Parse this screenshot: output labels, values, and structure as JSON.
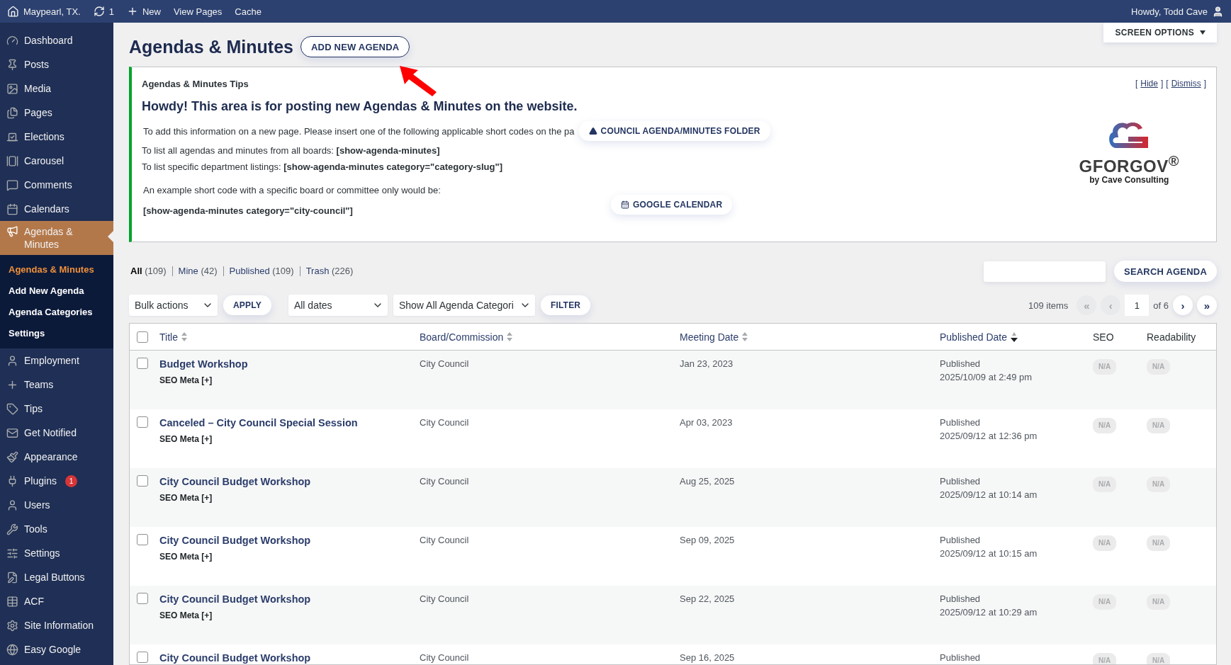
{
  "topbar": {
    "site": "Maypearl, TX.",
    "updates": "1",
    "new": "New",
    "links": [
      "View Pages",
      "Cache"
    ],
    "greeting": "Howdy, Todd Cave"
  },
  "sidebar": {
    "items": [
      {
        "label": "Dashboard",
        "selected": false
      },
      {
        "label": "Posts",
        "selected": false
      },
      {
        "label": "Media",
        "selected": false
      },
      {
        "label": "Pages",
        "selected": false
      },
      {
        "label": "Elections",
        "selected": false
      },
      {
        "label": "Carousel",
        "selected": false
      },
      {
        "label": "Comments",
        "selected": false
      },
      {
        "label": "Calendars",
        "selected": false
      },
      {
        "label": "Agendas & Minutes",
        "selected": true,
        "children": [
          {
            "label": "Agendas & Minutes",
            "selected": true
          },
          {
            "label": "Add New Agenda",
            "selected": false
          },
          {
            "label": "Agenda Categories",
            "selected": false
          },
          {
            "label": "Settings",
            "selected": false
          }
        ]
      },
      {
        "label": "Employment",
        "selected": false
      },
      {
        "label": "Teams",
        "selected": false
      },
      {
        "label": "Tips",
        "selected": false
      },
      {
        "label": "Get Notified",
        "selected": false
      },
      {
        "label": "Appearance",
        "selected": false
      },
      {
        "label": "Plugins",
        "selected": false,
        "badge": "1"
      },
      {
        "label": "Users",
        "selected": false
      },
      {
        "label": "Tools",
        "selected": false
      },
      {
        "label": "Settings",
        "selected": false
      },
      {
        "label": "Legal Buttons",
        "selected": false
      },
      {
        "label": "ACF",
        "selected": false
      },
      {
        "label": "Site Information",
        "selected": false
      },
      {
        "label": "Easy Google",
        "selected": false
      }
    ]
  },
  "screen_options": "SCREEN OPTIONS",
  "page_title": "Agendas & Minutes",
  "add_new_button": "ADD NEW AGENDA",
  "tips": {
    "title": "Agendas & Minutes Tips",
    "headline": "Howdy! This area is for posting new Agendas & Minutes on the website.",
    "intro": "To add this information on a new page. Please insert one of the following applicable short codes on the pa",
    "lines": [
      "To list all agendas and minutes from all boards: **[show-agenda-minutes]**",
      "To list specific department listings: **[show-agenda-minutes category=\"category-slug\"]**"
    ],
    "example": "An example short code with a specific board or committee only would be:",
    "example_code": "[show-agenda-minutes category=\"city-council\"]",
    "folder_button": "COUNCIL AGENDA/MINUTES FOLDER",
    "calendar_button": "GOOGLE CALENDAR",
    "links": [
      {
        "open": "[",
        "label": "Hide",
        "close": "]"
      },
      {
        "open": "[",
        "label": "Dismiss",
        "close": "]"
      }
    ],
    "logo": {
      "name": "GFORGOV",
      "mark": "®",
      "byline": "by Cave Consulting"
    }
  },
  "views": [
    {
      "label": "All",
      "count": "(109)",
      "selected": true
    },
    {
      "label": "Mine",
      "count": "(42)",
      "selected": false
    },
    {
      "label": "Published",
      "count": "(109)",
      "selected": false
    },
    {
      "label": "Trash",
      "count": "(226)",
      "selected": false
    }
  ],
  "search": {
    "button": "SEARCH AGENDA"
  },
  "toolbar": {
    "bulk": "Bulk actions",
    "apply": "APPLY",
    "dates": "All dates",
    "categories": "Show All Agenda Categori",
    "filter": "FILTER"
  },
  "pagination": {
    "items": "109 items",
    "first": {
      "label": "«",
      "disabled": true
    },
    "prev": {
      "label": "‹",
      "disabled": true
    },
    "page": "1",
    "of": "of 6",
    "next": {
      "label": "›",
      "disabled": false
    },
    "last": {
      "label": "»",
      "disabled": false
    }
  },
  "table": {
    "select_all": false,
    "columns": [
      {
        "label": "Title",
        "sortable": true,
        "sorted": false
      },
      {
        "label": "Board/Commission",
        "sortable": true,
        "sorted": false
      },
      {
        "label": "Meeting Date",
        "sortable": true,
        "sorted": false
      },
      {
        "label": "Published Date",
        "sortable": true,
        "sorted": true
      },
      {
        "label": "SEO",
        "sortable": false
      },
      {
        "label": "Readability",
        "sortable": false
      }
    ],
    "rows": [
      {
        "checked": false,
        "title": "Budget Workshop",
        "meta": "SEO Meta [+]",
        "board": "City Council",
        "meeting": "Jan 23, 2023",
        "status": "Published",
        "published": "2025/10/09 at 2:49 pm",
        "seo": "N/A",
        "readability": "N/A"
      },
      {
        "checked": false,
        "title": "Canceled – City Council Special Session",
        "meta": "SEO Meta [+]",
        "board": "City Council",
        "meeting": "Apr 03, 2023",
        "status": "Published",
        "published": "2025/09/12 at 12:36 pm",
        "seo": "N/A",
        "readability": "N/A"
      },
      {
        "checked": false,
        "title": "City Council Budget Workshop",
        "meta": "SEO Meta [+]",
        "board": "City Council",
        "meeting": "Aug 25, 2025",
        "status": "Published",
        "published": "2025/09/12 at 10:14 am",
        "seo": "N/A",
        "readability": "N/A"
      },
      {
        "checked": false,
        "title": "City Council Budget Workshop",
        "meta": "SEO Meta [+]",
        "board": "City Council",
        "meeting": "Sep 09, 2025",
        "status": "Published",
        "published": "2025/09/12 at 10:15 am",
        "seo": "N/A",
        "readability": "N/A"
      },
      {
        "checked": false,
        "title": "City Council Budget Workshop",
        "meta": "SEO Meta [+]",
        "board": "City Council",
        "meeting": "Sep 22, 2025",
        "status": "Published",
        "published": "2025/09/12 at 10:29 am",
        "seo": "N/A",
        "readability": "N/A"
      },
      {
        "checked": false,
        "title": "City Council Budget Workshop",
        "board": "City Council",
        "meeting": "Sep 16, 2025",
        "status": "Published",
        "seo": "N/A",
        "readability": "N/A"
      }
    ]
  }
}
